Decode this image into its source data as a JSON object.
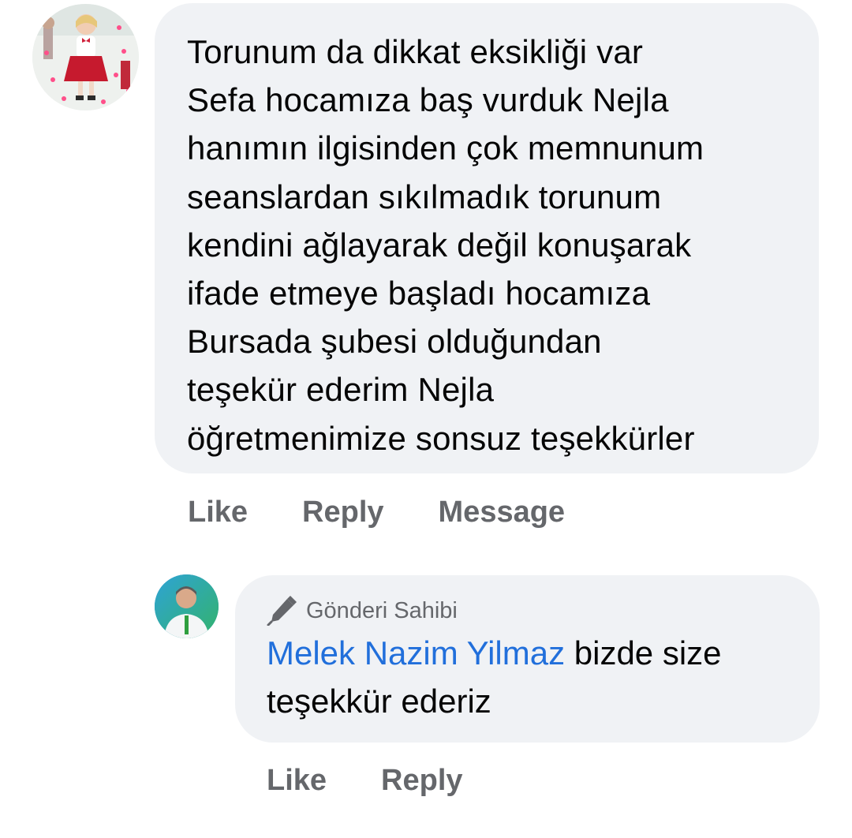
{
  "comment": {
    "text": "Torunum da dikkat eksikliği var\nSefa hocamıza baş vurduk Nejla\nhanımın ilgisinden çok memnunum\nseanslardan sıkılmadık torunum\nkendini ağlayarak değil konuşarak\nifade etmeye başladı hocamıza\nBursada şubesi olduğundan\nteşekür ederim Nejla\nöğretmenimize sonsuz teşekkürler",
    "avatar_icon": "child-photo-avatar",
    "actions": {
      "like": "Like",
      "reply": "Reply",
      "message": "Message"
    }
  },
  "reply": {
    "avatar_icon": "man-photo-avatar",
    "badge_icon": "pen-icon",
    "badge_label": "Gönderi Sahibi",
    "mention": "Melek Nazim Yilmaz",
    "text": " bizde size teşekkür ederiz",
    "actions": {
      "like": "Like",
      "reply": "Reply"
    }
  },
  "colors": {
    "bubble_bg": "#f0f2f5",
    "text": "#050505",
    "muted": "#65676b",
    "link": "#216fdb"
  }
}
